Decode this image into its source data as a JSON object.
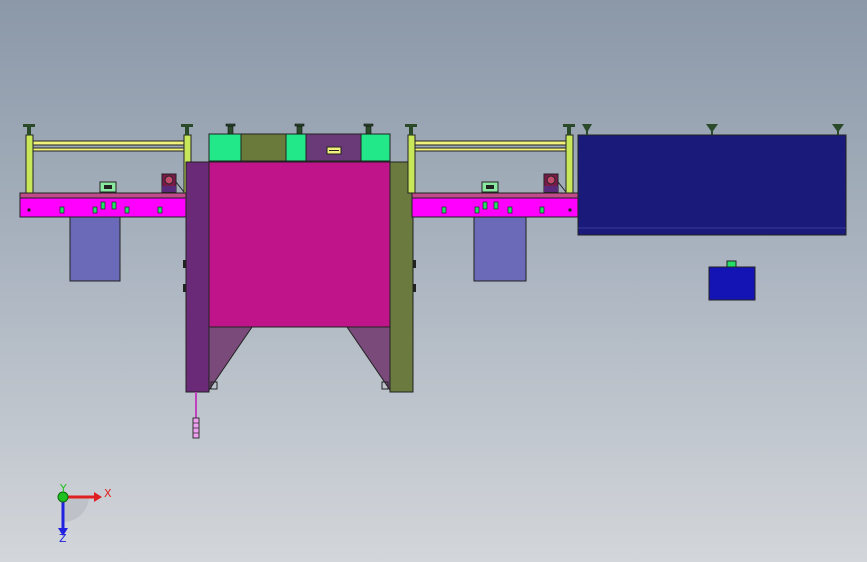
{
  "viewport": {
    "background_top": "#8b98a8",
    "background_bottom": "#d3d6da"
  },
  "colors": {
    "rail_magenta": "#ff00ff",
    "press_body": "#c0148a",
    "press_left_column": "#6a2a78",
    "press_right_column": "#6b7a3e",
    "crown_green": "#22e88a",
    "crown_olive": "#6a7a3a",
    "crown_purple": "#6a3a78",
    "frame_yellow": "#f0f07a",
    "frame_yellowgreen": "#c8e85a",
    "bin_lavender": "#6a6ab8",
    "conveyor_navy": "#1a1a7a",
    "motor_blue": "#1414b4",
    "motor_green": "#22dd66",
    "axis_x": "#e02020",
    "axis_y": "#20c020",
    "axis_z": "#2020e0"
  },
  "triad": {
    "x_label": "X",
    "y_label": "Y",
    "z_label": "Z"
  }
}
